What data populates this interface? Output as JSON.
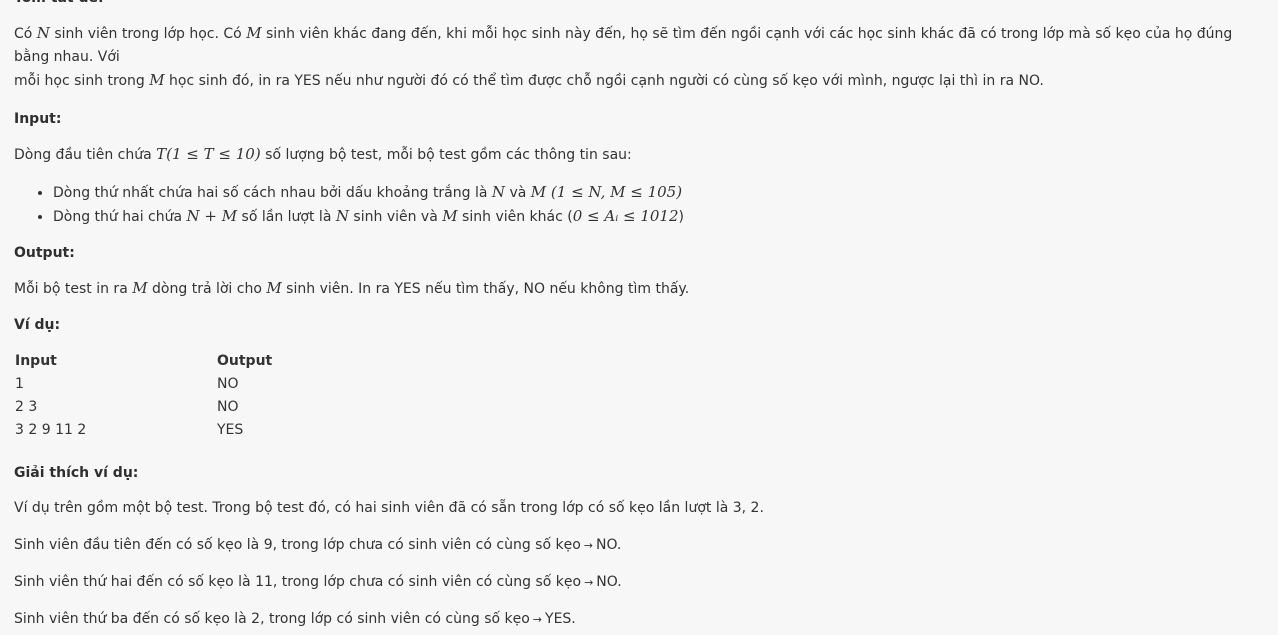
{
  "summary": {
    "title": "Tóm tắt đề:",
    "p1_a": "Có ",
    "p1_N": "N",
    "p1_b": " sinh viên trong lớp học. Có ",
    "p1_M": "M",
    "p1_c": " sinh viên khác đang đến, khi mỗi học sinh này đến, họ sẽ tìm đến ngồi cạnh với các học sinh khác đã có trong lớp mà số kẹo của họ đúng bằng nhau. Với",
    "p2_a": "mỗi học sinh trong ",
    "p2_M": "M",
    "p2_b": " học sinh đó, in ra YES nếu như người đó có thể tìm được chỗ ngồi cạnh người có cùng số kẹo với mình, ngược lại thì in ra NO."
  },
  "input": {
    "title": "Input:",
    "line_a": "Dòng đầu tiên chứa ",
    "line_math": "T(1 ≤ T ≤ 10)",
    "line_b": " số lượng bộ test, mỗi bộ test gồm các thông tin sau:",
    "bullet1_a": "Dòng thứ nhất chứa hai số cách nhau bởi dấu khoảng trắng là ",
    "bullet1_N": "N",
    "bullet1_b": " và ",
    "bullet1_M": "M",
    "bullet1_math": " (1 ≤ N, M ≤ 105)",
    "bullet2_a": "Dòng thứ hai chứa ",
    "bullet2_math": "N + M",
    "bullet2_b": " số lần lượt là ",
    "bullet2_N": "N",
    "bullet2_c": " sinh viên và ",
    "bullet2_M": "M",
    "bullet2_d": " sinh viên khác (",
    "bullet2_math2": "0 ≤ Aᵢ ≤ 1012",
    "bullet2_e": ")"
  },
  "output": {
    "title": "Output:",
    "line_a": "Mỗi bộ test in ra ",
    "line_M1": "M",
    "line_b": " dòng trả lời cho ",
    "line_M2": "M",
    "line_c": " sinh viên. In ra YES nếu tìm thấy, NO nếu không tìm thấy."
  },
  "example": {
    "title": "Ví dụ:",
    "headers": [
      "Input",
      "Output"
    ],
    "rows": [
      [
        "1",
        "NO"
      ],
      [
        "2 3",
        "NO"
      ],
      [
        "3 2 9 11 2",
        "YES"
      ]
    ]
  },
  "explanation": {
    "title": "Giải thích ví dụ:",
    "p1": "Ví dụ trên gồm một bộ test. Trong bộ test đó, có hai sinh viên đã có sẵn trong lớp có số kẹo lần lượt là 3, 2.",
    "p2_a": "Sinh viên đầu tiên đến có số kẹo là 9, trong lớp chưa có sinh viên có cùng số kẹo",
    "p2_b": "NO.",
    "p3_a": "Sinh viên thứ hai đến có số kẹo là 11, trong lớp chưa có sinh viên có cùng số kẹo",
    "p3_b": "NO.",
    "p4_a": "Sinh viên thứ ba đến có số kẹo là 2, trong lớp có sinh viên có cùng số kẹo",
    "p4_b": "YES.",
    "arrow": "→"
  }
}
